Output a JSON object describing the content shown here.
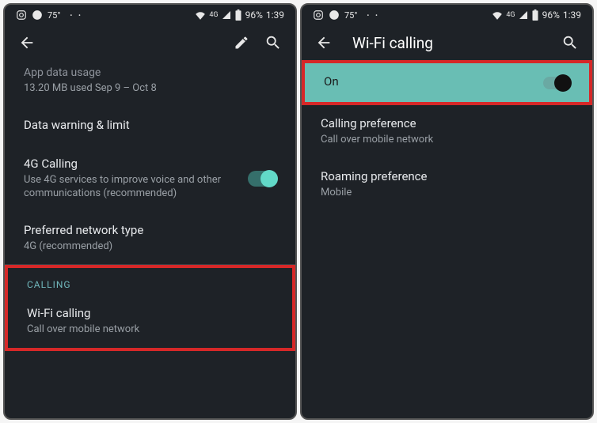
{
  "status": {
    "temp": "75°",
    "network_label": "4G",
    "battery": "96%",
    "time": "1:39"
  },
  "screen1": {
    "items": {
      "data_usage": {
        "title": "App data usage",
        "sub": "13.20 MB used Sep 9 – Oct 8"
      },
      "warning": {
        "title": "Data warning & limit"
      },
      "calling4g": {
        "title": "4G Calling",
        "sub": "Use 4G services to improve voice and other communications (recommended)"
      },
      "network_type": {
        "title": "Preferred network type",
        "sub": "4G (recommended)"
      },
      "section_calling": "CALLING",
      "wifi_calling": {
        "title": "Wi-Fi calling",
        "sub": "Call over mobile network"
      }
    }
  },
  "screen2": {
    "title": "Wi-Fi calling",
    "items": {
      "on": {
        "title": "On"
      },
      "pref": {
        "title": "Calling preference",
        "sub": "Call over mobile network"
      },
      "roaming": {
        "title": "Roaming preference",
        "sub": "Mobile"
      }
    }
  }
}
